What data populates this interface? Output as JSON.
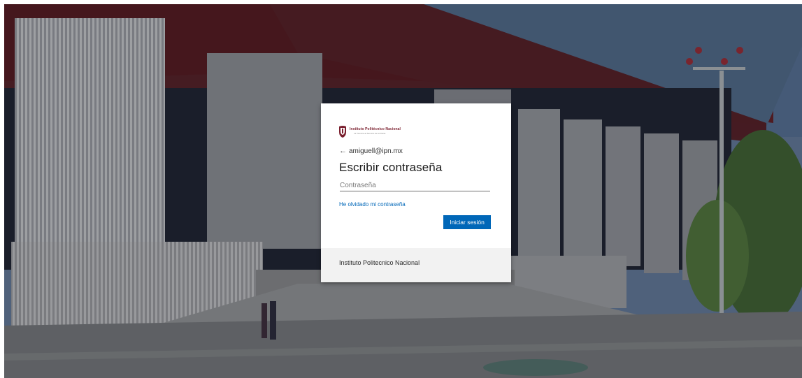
{
  "login": {
    "logo": {
      "name": "Instituto Politécnico Nacional",
      "tagline": "La Técnica al Servicio de la Patria"
    },
    "back_icon": "back-arrow-icon",
    "back_glyph": "←",
    "email": "amiguell@ipn.mx",
    "heading": "Escribir contraseña",
    "password": {
      "placeholder": "Contraseña",
      "value": ""
    },
    "forgot_link": "He olvidado mi contraseña",
    "signin_button": "Iniciar sesión",
    "footer_text": "Instituto Politecnico Nacional",
    "colors": {
      "accent": "#0067b8",
      "brand": "#7a1f2e",
      "footer_bg": "#f2f2f2"
    }
  }
}
